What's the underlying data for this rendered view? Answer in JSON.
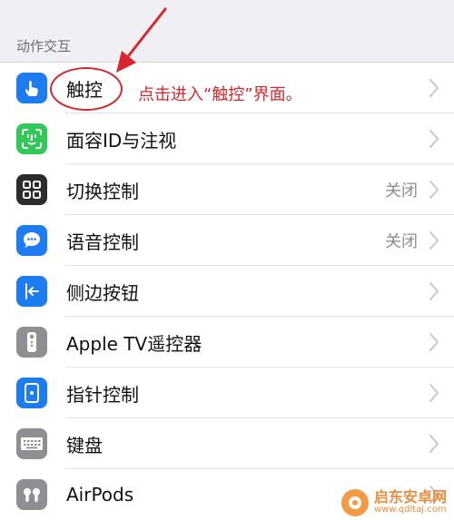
{
  "section": {
    "header": "动作交互"
  },
  "rows": [
    {
      "label": "触控",
      "value": "",
      "icon": "hand-touch-icon",
      "color": "#1e7cf2"
    },
    {
      "label": "面容ID与注视",
      "value": "",
      "icon": "face-id-icon",
      "color": "#34c759"
    },
    {
      "label": "切换控制",
      "value": "关闭",
      "icon": "switch-control-icon",
      "color": "#2c2c2e"
    },
    {
      "label": "语音控制",
      "value": "关闭",
      "icon": "voice-control-icon",
      "color": "#1e7cf2"
    },
    {
      "label": "侧边按钮",
      "value": "",
      "icon": "side-button-icon",
      "color": "#1e7cf2"
    },
    {
      "label": "Apple TV遥控器",
      "value": "",
      "icon": "tv-remote-icon",
      "color": "#8e8e93"
    },
    {
      "label": "指针控制",
      "value": "",
      "icon": "pointer-control-icon",
      "color": "#1e7cf2"
    },
    {
      "label": "键盘",
      "value": "",
      "icon": "keyboard-icon",
      "color": "#8e8e93"
    },
    {
      "label": "AirPods",
      "value": "",
      "icon": "airpods-icon",
      "color": "#8e8e93"
    }
  ],
  "annotation": {
    "text": "点击进入“触控”界面。",
    "color": "#d7262d"
  },
  "watermark": {
    "title": "启东安卓网",
    "url": "www.qdltaj.com"
  }
}
